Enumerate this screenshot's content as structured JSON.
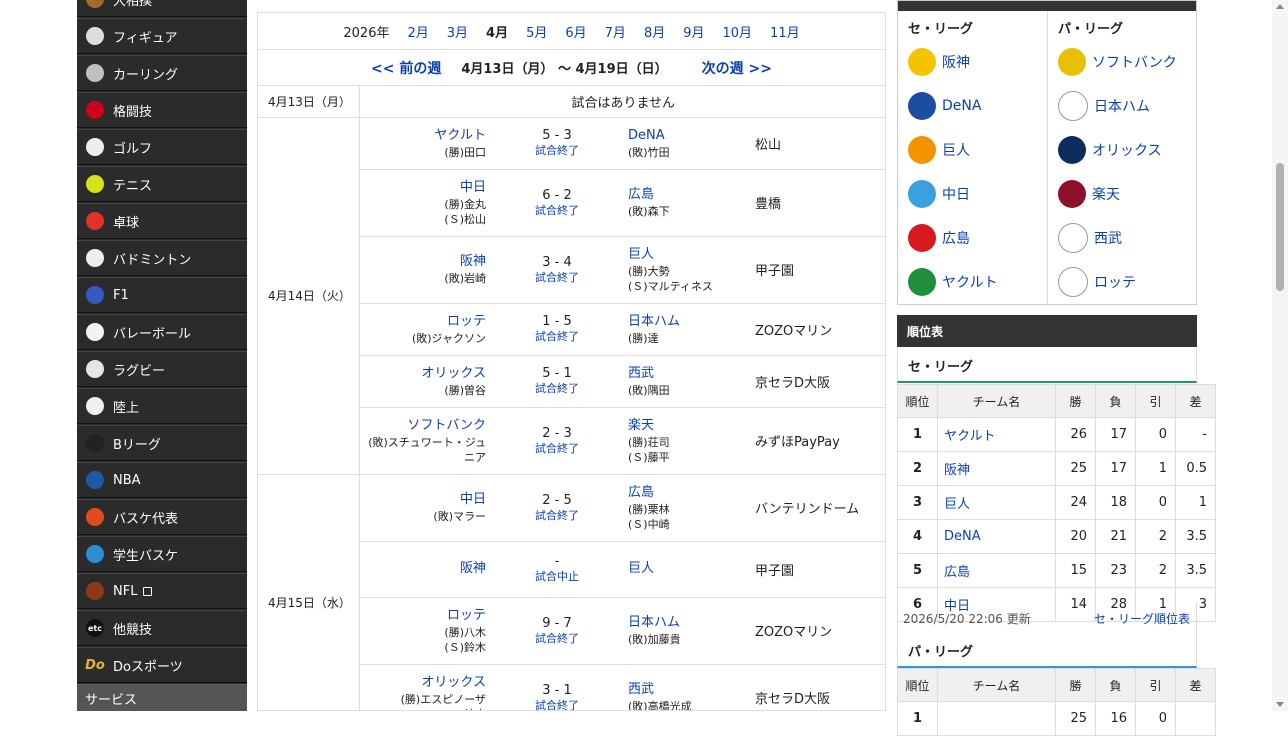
{
  "sidebar": {
    "items": [
      {
        "label": "大相撲",
        "icon": "sumo-icon",
        "color": "#a36b2a"
      },
      {
        "label": "フィギュア",
        "icon": "skate-icon",
        "color": "#dddddd"
      },
      {
        "label": "カーリング",
        "icon": "curling-stone-icon",
        "color": "#c0c0c0"
      },
      {
        "label": "格闘技",
        "icon": "boxing-glove-icon",
        "color": "#d0021b"
      },
      {
        "label": "ゴルフ",
        "icon": "golf-icon",
        "color": "#eeeeee"
      },
      {
        "label": "テニス",
        "icon": "tennis-ball-icon",
        "color": "#d6e319"
      },
      {
        "label": "卓球",
        "icon": "table-tennis-icon",
        "color": "#e0312b"
      },
      {
        "label": "バドミントン",
        "icon": "shuttlecock-icon",
        "color": "#eeeeee"
      },
      {
        "label": "F1",
        "icon": "race-car-icon",
        "color": "#3658c4"
      },
      {
        "label": "バレーボール",
        "icon": "volleyball-icon",
        "color": "#f2f2f2"
      },
      {
        "label": "ラグビー",
        "icon": "rugby-ball-icon",
        "color": "#e6e6e6"
      },
      {
        "label": "陸上",
        "icon": "running-shoe-icon",
        "color": "#f0f0f0"
      },
      {
        "label": "Bリーグ",
        "icon": "basketball-icon",
        "color": "#222222"
      },
      {
        "label": "NBA",
        "icon": "nba-basketball-icon",
        "color": "#1f5aa8"
      },
      {
        "label": "バスケ代表",
        "icon": "basketball-orange-icon",
        "color": "#e04b1a"
      },
      {
        "label": "学生バスケ",
        "icon": "basketball-blue-icon",
        "color": "#2e8ed3"
      },
      {
        "label": "NFL",
        "icon": "american-football-icon",
        "color": "#8b3a1a",
        "external": "external-link-icon"
      },
      {
        "label": "他競技",
        "icon": "etc-icon",
        "color": "#111111",
        "icon_text": "etc"
      },
      {
        "label": "Doスポーツ",
        "icon": "do-sports-icon",
        "color": "#e3b53a",
        "icon_text": "Do"
      }
    ],
    "service_label": "サービス"
  },
  "months": {
    "year": "2026年",
    "items": [
      "2月",
      "3月",
      "4月",
      "5月",
      "6月",
      "7月",
      "8月",
      "9月",
      "10月",
      "11月"
    ],
    "current": "4月"
  },
  "week_nav": {
    "prev": "<< 前の週",
    "range": "4月13日（月） ～ 4月19日（日）",
    "next": "次の週 >>"
  },
  "schedule": [
    {
      "date": "4月13日（月）",
      "no_game": "試合はありません"
    },
    {
      "date": "4月14日（火）",
      "games": [
        {
          "home": "ヤクルト",
          "home_p": [
            "(勝)田口"
          ],
          "score": "5 - 3",
          "status": "試合終了",
          "away": "DeNA",
          "away_p": [
            "(敗)竹田"
          ],
          "venue": "松山"
        },
        {
          "home": "中日",
          "home_p": [
            "(勝)金丸",
            "(Ｓ)松山"
          ],
          "score": "6 - 2",
          "status": "試合終了",
          "away": "広島",
          "away_p": [
            "(敗)森下"
          ],
          "venue": "豊橋"
        },
        {
          "home": "阪神",
          "home_p": [
            "(敗)岩崎"
          ],
          "score": "3 - 4",
          "status": "試合終了",
          "away": "巨人",
          "away_p": [
            "(勝)大勢",
            "(Ｓ)マルティネス"
          ],
          "venue": "甲子園"
        },
        {
          "home": "ロッテ",
          "home_p": [
            "(敗)ジャクソン"
          ],
          "score": "1 - 5",
          "status": "試合終了",
          "away": "日本ハム",
          "away_p": [
            "(勝)達"
          ],
          "venue": "ZOZOマリン"
        },
        {
          "home": "オリックス",
          "home_p": [
            "(勝)曽谷"
          ],
          "score": "5 - 1",
          "status": "試合終了",
          "away": "西武",
          "away_p": [
            "(敗)隅田"
          ],
          "venue": "京セラD大阪"
        },
        {
          "home": "ソフトバンク",
          "home_p": [
            "(敗)スチュワート・ジュニア"
          ],
          "score": "2 - 3",
          "status": "試合終了",
          "away": "楽天",
          "away_p": [
            "(勝)荘司",
            "(Ｓ)藤平"
          ],
          "venue": "みずほPayPay"
        }
      ]
    },
    {
      "date": "4月15日（水）",
      "games": [
        {
          "home": "中日",
          "home_p": [
            "(敗)マラー"
          ],
          "score": "2 - 5",
          "status": "試合終了",
          "away": "広島",
          "away_p": [
            "(勝)栗林",
            "(Ｓ)中崎"
          ],
          "venue": "バンテリンドーム"
        },
        {
          "home": "阪神",
          "home_p": [],
          "score": "-",
          "status": "試合中止",
          "away": "巨人",
          "away_p": [],
          "venue": "甲子園"
        },
        {
          "home": "ロッテ",
          "home_p": [
            "(勝)八木",
            "(Ｓ)鈴木"
          ],
          "score": "9 - 7",
          "status": "試合終了",
          "away": "日本ハム",
          "away_p": [
            "(敗)加藤貴"
          ],
          "venue": "ZOZOマリン"
        },
        {
          "home": "オリックス",
          "home_p": [
            "(勝)エスピノーザ",
            "(Ｓ)椋木"
          ],
          "score": "3 - 1",
          "status": "試合終了",
          "away": "西武",
          "away_p": [
            "(敗)高橋光成"
          ],
          "venue": "京セラD大阪"
        }
      ]
    }
  ],
  "teams": {
    "central_label": "セ・リーグ",
    "pacific_label": "パ・リーグ",
    "central": [
      {
        "name": "阪神",
        "logo": "tigers-logo-icon",
        "color": "#f5c400",
        "text_color": "#111111"
      },
      {
        "name": "DeNA",
        "logo": "baystars-logo-icon",
        "color": "#1b4ea0",
        "text_color": "#ffffff"
      },
      {
        "name": "巨人",
        "logo": "giants-logo-icon",
        "color": "#f29400",
        "text_color": "#111111"
      },
      {
        "name": "中日",
        "logo": "dragons-logo-icon",
        "color": "#3aa0e0",
        "text_color": "#ffffff"
      },
      {
        "name": "広島",
        "logo": "carp-logo-icon",
        "color": "#d71920",
        "text_color": "#ffffff"
      },
      {
        "name": "ヤクルト",
        "logo": "swallows-logo-icon",
        "color": "#1f8f3a",
        "text_color": "#ffffff"
      }
    ],
    "pacific": [
      {
        "name": "ソフトバンク",
        "logo": "hawks-logo-icon",
        "color": "#e7c000",
        "text_color": "#111111"
      },
      {
        "name": "日本ハム",
        "logo": "fighters-logo-icon",
        "color": "#ffffff",
        "text_color": "#0b2f6e"
      },
      {
        "name": "オリックス",
        "logo": "buffaloes-logo-icon",
        "color": "#0a2d5c",
        "text_color": "#ffffff"
      },
      {
        "name": "楽天",
        "logo": "eagles-logo-icon",
        "color": "#8c0f2b",
        "text_color": "#ffffff"
      },
      {
        "name": "西武",
        "logo": "lions-logo-icon",
        "color": "#ffffff",
        "text_color": "#1b3f8f"
      },
      {
        "name": "ロッテ",
        "logo": "marines-logo-icon",
        "color": "#ffffff",
        "text_color": "#111111"
      }
    ]
  },
  "standings": {
    "title": "順位表",
    "central_label": "セ・リーグ",
    "pacific_label": "パ・リーグ",
    "headers": [
      "順位",
      "チーム名",
      "勝",
      "負",
      "引",
      "差"
    ],
    "central_rows": [
      [
        "1",
        "ヤクルト",
        "26",
        "17",
        "0",
        "-"
      ],
      [
        "2",
        "阪神",
        "25",
        "17",
        "1",
        "0.5"
      ],
      [
        "3",
        "巨人",
        "24",
        "18",
        "0",
        "1"
      ],
      [
        "4",
        "DeNA",
        "20",
        "21",
        "2",
        "3.5"
      ],
      [
        "5",
        "広島",
        "15",
        "23",
        "2",
        "3.5"
      ],
      [
        "6",
        "中日",
        "14",
        "28",
        "1",
        "3"
      ]
    ],
    "updated": "2026/5/20 22:06 更新",
    "central_link": "セ・リーグ順位表",
    "pacific_first_row": [
      "1",
      "",
      "25",
      "16",
      "0",
      ""
    ]
  },
  "colors": {
    "link": "#0b3fb0",
    "central_accent": "#1e9a57",
    "pacific_accent": "#2a9ccf",
    "header_dark": "#333333"
  }
}
